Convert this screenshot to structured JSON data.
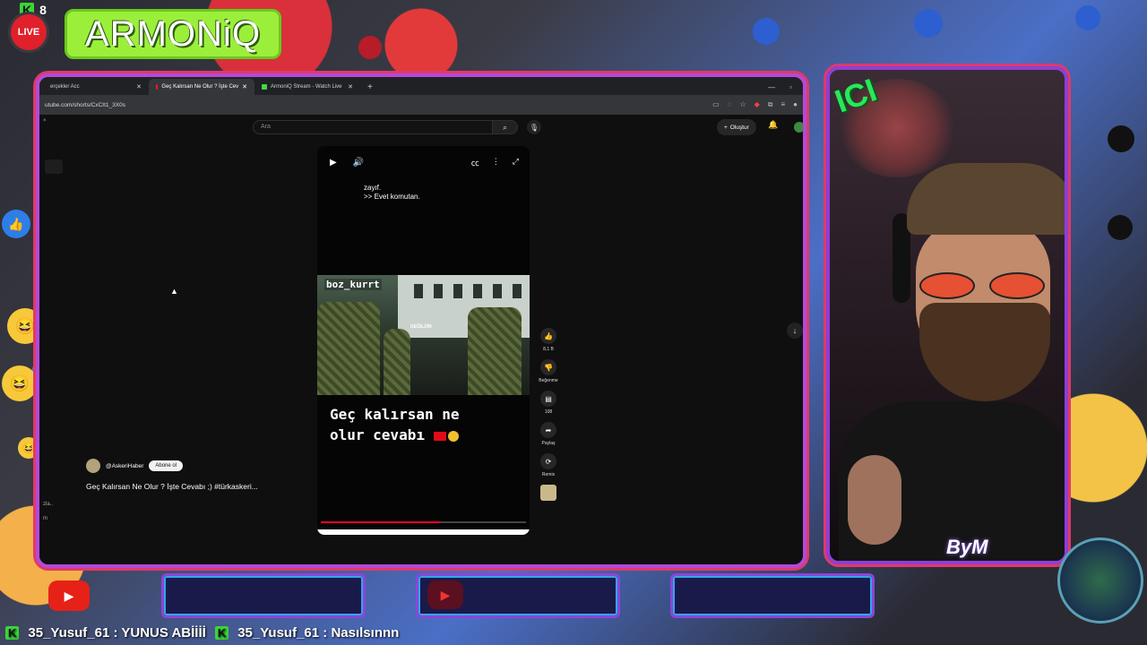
{
  "stream": {
    "viewer_count": "8",
    "live_label": "LIVE",
    "brand_name": "ARMONiQ",
    "signature": "ByM",
    "accent_green": "#9bef3a",
    "frame_purple": "#b24ad8"
  },
  "browser": {
    "tabs": [
      {
        "label": "erçekler Acc",
        "active": false
      },
      {
        "label": "Geç Kalırsan Ne Olur ? İşte Cev",
        "active": true
      },
      {
        "label": "ArmoniQ Stream - Watch Live",
        "active": false
      }
    ],
    "new_tab": "+",
    "url": "utube.com/shorts/CxCIt1_3X0s"
  },
  "youtube": {
    "search_placeholder": "Ara",
    "create_label": "Oluştur",
    "short": {
      "caption_line1": "zayıf.",
      "caption_line2": ">> Evet komutan.",
      "clip_tag": "boz_kurrt",
      "clip_sign": "DEĞİLDİR",
      "title_line1": "Geç kalırsan ne",
      "title_line2": "olur cevabı",
      "progress": 0.58
    },
    "actions": {
      "like_count": "8,1 B",
      "dislike_label": "Beğenme",
      "comment_count": "108",
      "share_label": "Paylaş",
      "remix_label": "Remix"
    },
    "channel": "@AskeriHaber",
    "subscribe_label": "Abone ol",
    "video_title": "Geç Kalırsan Ne Olur ? İşte Cevabı ;) #türkaskeri...",
    "sidebar_fragments": [
      "zla..",
      "m"
    ]
  },
  "chat_ticker": [
    {
      "user": "35_Yusuf_61",
      "message": "YUNUS ABİİİİ"
    },
    {
      "user": "35_Yusuf_61",
      "message": "Nasılsınnn"
    }
  ]
}
